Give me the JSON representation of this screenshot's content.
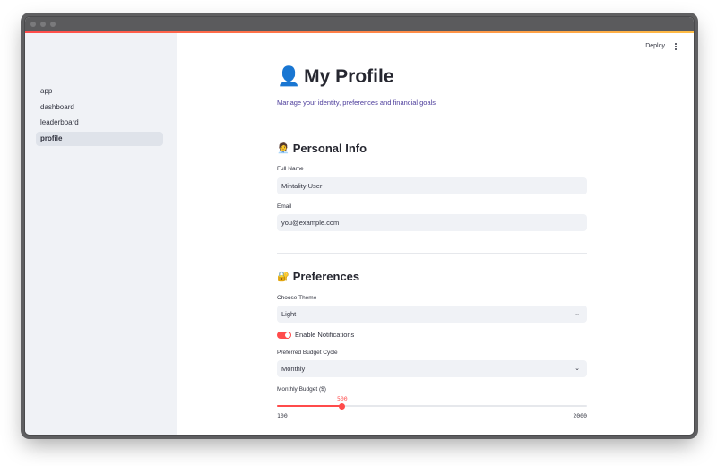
{
  "sidebar": {
    "items": [
      {
        "label": "app",
        "active": false
      },
      {
        "label": "dashboard",
        "active": false
      },
      {
        "label": "leaderboard",
        "active": false
      },
      {
        "label": "profile",
        "active": true
      }
    ]
  },
  "header": {
    "deploy_label": "Deploy",
    "menu_icon": "kebab-menu-icon"
  },
  "page": {
    "title_icon": "👤",
    "title": "My Profile",
    "subtitle": "Manage your identity, preferences and financial goals"
  },
  "personal": {
    "heading_icon": "🧑‍💼",
    "heading": "Personal Info",
    "full_name_label": "Full Name",
    "full_name_value": "Mintality User",
    "email_label": "Email",
    "email_value": "you@example.com"
  },
  "preferences": {
    "heading_icon": "🔐",
    "heading": "Preferences",
    "theme_label": "Choose Theme",
    "theme_value": "Light",
    "notifications_label": "Enable Notifications",
    "notifications_enabled": true,
    "budget_cycle_label": "Preferred Budget Cycle",
    "budget_cycle_value": "Monthly",
    "budget_label": "Monthly Budget ($)",
    "budget_value": "500",
    "budget_min": "100",
    "budget_max": "2000"
  },
  "colors": {
    "accent": "#ff4b4b",
    "sidebar_bg": "#f0f2f6",
    "subtitle": "#4b3b9a"
  }
}
